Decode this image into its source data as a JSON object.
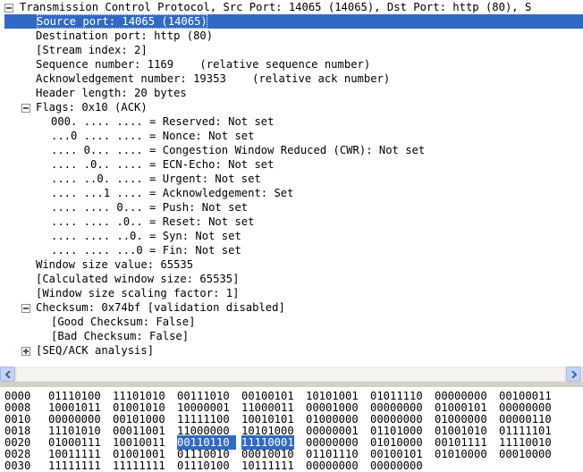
{
  "tree": {
    "rows": [
      {
        "text": "Transmission Control Protocol, Src Port: 14065 (14065), Dst Port: http (80), S",
        "toggle": "minus",
        "depth": 0
      },
      {
        "text": "Source port: 14065 (14065)",
        "depth": 1,
        "selected": true
      },
      {
        "text": "Destination port: http (80)",
        "depth": 1
      },
      {
        "text": "[Stream index: 2]",
        "depth": 1
      },
      {
        "text": "Sequence number: 1169    (relative sequence number)",
        "depth": 1
      },
      {
        "text": "Acknowledgement number: 19353    (relative ack number)",
        "depth": 1
      },
      {
        "text": "Header length: 20 bytes",
        "depth": 1
      },
      {
        "text": "Flags: 0x10 (ACK)",
        "toggle": "minus",
        "depth": 1
      },
      {
        "text": "000. .... .... = Reserved: Not set",
        "depth": 2
      },
      {
        "text": "...0 .... .... = Nonce: Not set",
        "depth": 2
      },
      {
        "text": ".... 0... .... = Congestion Window Reduced (CWR): Not set",
        "depth": 2
      },
      {
        "text": ".... .0.. .... = ECN-Echo: Not set",
        "depth": 2
      },
      {
        "text": ".... ..0. .... = Urgent: Not set",
        "depth": 2
      },
      {
        "text": ".... ...1 .... = Acknowledgement: Set",
        "depth": 2
      },
      {
        "text": ".... .... 0... = Push: Not set",
        "depth": 2
      },
      {
        "text": ".... .... .0.. = Reset: Not set",
        "depth": 2
      },
      {
        "text": ".... .... ..0. = Syn: Not set",
        "depth": 2
      },
      {
        "text": ".... .... ...0 = Fin: Not set",
        "depth": 2
      },
      {
        "text": "Window size value: 65535",
        "depth": 1
      },
      {
        "text": "[Calculated window size: 65535]",
        "depth": 1
      },
      {
        "text": "[Window size scaling factor: 1]",
        "depth": 1
      },
      {
        "text": "Checksum: 0x74bf [validation disabled]",
        "toggle": "minus",
        "depth": 1
      },
      {
        "text": "[Good Checksum: False]",
        "depth": 2
      },
      {
        "text": "[Bad Checksum: False]",
        "depth": 2
      },
      {
        "text": "[SEQ/ACK analysis]",
        "toggle": "plus",
        "depth": 1
      }
    ]
  },
  "bytes": {
    "rows": [
      {
        "offset": "0000",
        "groups": [
          "01110100",
          "11101010",
          "00111010",
          "00100101",
          "10101001",
          "01011110",
          "00000000",
          "00100011"
        ]
      },
      {
        "offset": "0008",
        "groups": [
          "10001011",
          "01001010",
          "10000001",
          "11000011",
          "00001000",
          "00000000",
          "01000101",
          "00000000"
        ]
      },
      {
        "offset": "0010",
        "groups": [
          "00000000",
          "00101000",
          "11111100",
          "10010101",
          "01000000",
          "00000000",
          "01000000",
          "00000110"
        ]
      },
      {
        "offset": "0018",
        "groups": [
          "11101010",
          "00011001",
          "11000000",
          "10101000",
          "00000001",
          "01101000",
          "01001010",
          "01111101"
        ]
      },
      {
        "offset": "0020",
        "groups": [
          "01000111",
          "10010011",
          "00110110",
          "11110001",
          "00000000",
          "01010000",
          "00101111",
          "11110010"
        ],
        "highlight": [
          2,
          3
        ]
      },
      {
        "offset": "0028",
        "groups": [
          "10011111",
          "01001001",
          "01110010",
          "00010010",
          "01101110",
          "00100101",
          "01010000",
          "00010000"
        ]
      },
      {
        "offset": "0030",
        "groups": [
          "11111111",
          "11111111",
          "01110100",
          "10111111",
          "00000000",
          "00000000"
        ]
      }
    ]
  }
}
